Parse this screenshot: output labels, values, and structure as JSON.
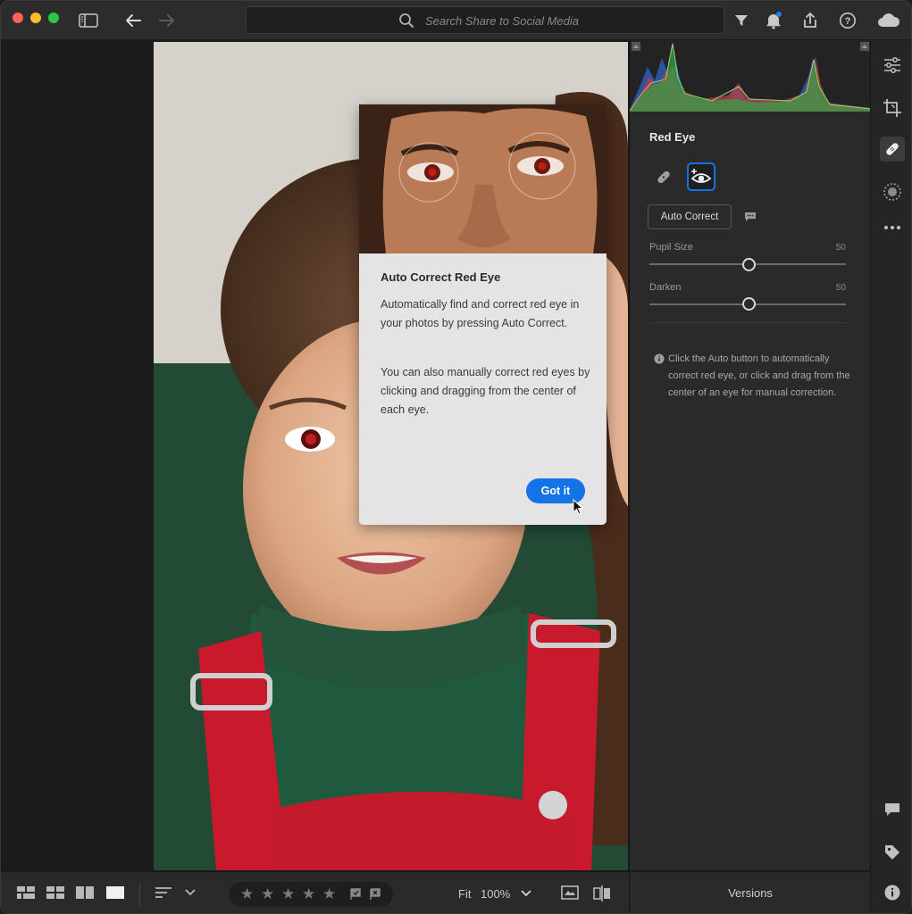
{
  "topbar": {
    "search_placeholder": "Search Share to Social Media"
  },
  "dialog": {
    "title": "Auto Correct Red Eye",
    "paragraph1": "Automatically find and correct red eye in your photos by pressing Auto Correct.",
    "paragraph2": "You can also manually correct red eyes by clicking and dragging from the center of each eye.",
    "button_label": "Got it"
  },
  "panel": {
    "title": "Red Eye",
    "auto_correct_label": "Auto Correct",
    "sliders": [
      {
        "label": "Pupil Size",
        "value": "50"
      },
      {
        "label": "Darken",
        "value": "50"
      }
    ],
    "info_text": "Click the Auto button to automatically correct red eye, or click and drag from the center of an eye for manual correction."
  },
  "bottombar": {
    "fit_label": "Fit",
    "zoom_label": "100%",
    "versions_label": "Versions"
  },
  "colors": {
    "accent": "#1473e6",
    "panel_bg": "#2a2a2a",
    "notification_dot": "#1e7cf0"
  },
  "icons": {
    "rail": [
      "sliders-icon",
      "crop-icon",
      "healing-icon",
      "mask-icon",
      "more-icon",
      "comment-icon",
      "tag-icon",
      "info-icon"
    ]
  }
}
